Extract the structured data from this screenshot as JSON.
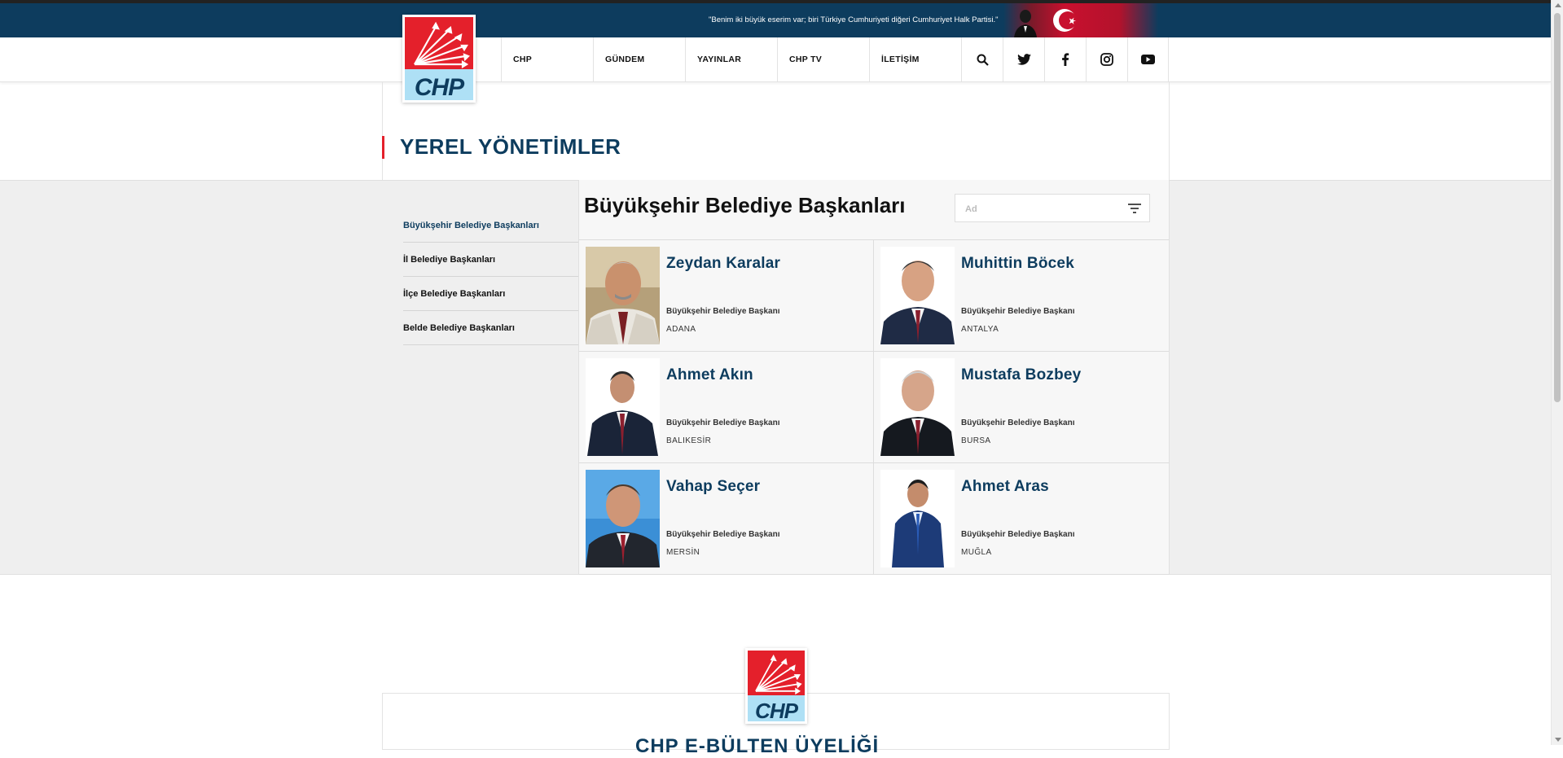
{
  "header": {
    "quote": "\"Benim iki büyük eserim var; biri Türkiye Cumhuriyeti diğeri Cumhuriyet Halk Partisi.\"",
    "logo_text": "CHP",
    "nav": [
      {
        "label": "CHP"
      },
      {
        "label": "GÜNDEM"
      },
      {
        "label": "YAYINLAR"
      },
      {
        "label": "CHP TV"
      },
      {
        "label": "İLETİŞİM"
      }
    ],
    "icons": [
      "search-icon",
      "twitter-icon",
      "facebook-icon",
      "instagram-icon",
      "youtube-icon"
    ]
  },
  "page": {
    "title": "YEREL YÖNETİMLER"
  },
  "sidebar": {
    "items": [
      {
        "label": "Büyükşehir Belediye Başkanları",
        "active": true
      },
      {
        "label": "İl Belediye Başkanları"
      },
      {
        "label": "İlçe Belediye Başkanları"
      },
      {
        "label": "Belde Belediye Başkanları"
      }
    ]
  },
  "main": {
    "section_title": "Büyükşehir Belediye Başkanları",
    "filter_placeholder": "Ad",
    "mayors": [
      {
        "name": "Zeydan Karalar",
        "role": "Büyükşehir Belediye Başkanı",
        "city": "ADANA"
      },
      {
        "name": "Muhittin Böcek",
        "role": "Büyükşehir Belediye Başkanı",
        "city": "ANTALYA"
      },
      {
        "name": "Ahmet Akın",
        "role": "Büyükşehir Belediye Başkanı",
        "city": "BALIKESİR"
      },
      {
        "name": "Mustafa Bozbey",
        "role": "Büyükşehir Belediye Başkanı",
        "city": "BURSA"
      },
      {
        "name": "Vahap Seçer",
        "role": "Büyükşehir Belediye Başkanı",
        "city": "MERSİN"
      },
      {
        "name": "Ahmet Aras",
        "role": "Büyükşehir Belediye Başkanı",
        "city": "MUĞLA"
      }
    ]
  },
  "footer": {
    "logo_text": "CHP",
    "heading": "CHP E-BÜLTEN ÜYELİĞİ"
  },
  "colors": {
    "brand_navy": "#0d3c5e",
    "brand_red": "#e4202b",
    "logo_blue": "#aee0f5"
  }
}
